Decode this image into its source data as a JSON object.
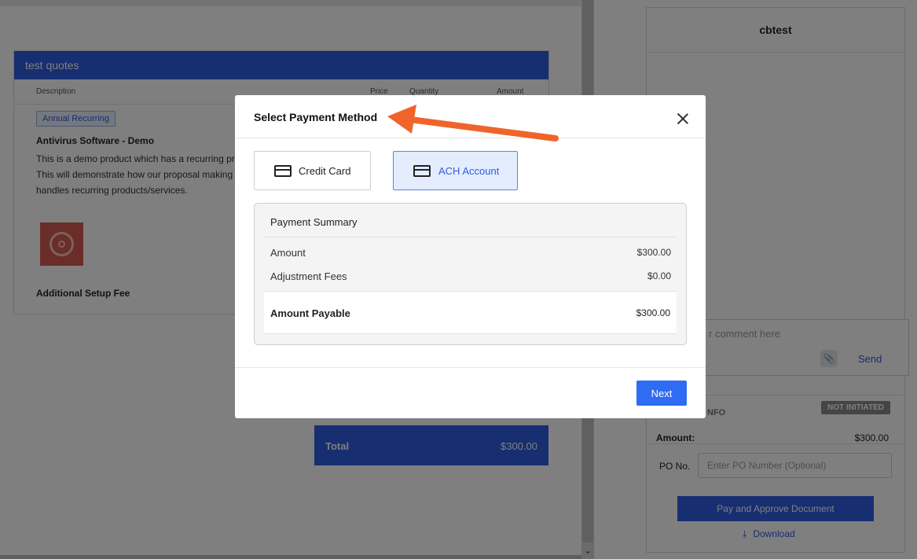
{
  "document": {
    "quote_title": "test quotes",
    "columns": {
      "description": "Description",
      "price": "Price",
      "quantity": "Quantity",
      "amount": "Amount"
    },
    "item": {
      "badge": "Annual Recurring",
      "name": "Antivirus Software - Demo",
      "description": "This is a demo product which has a recurring pr\nThis will demonstrate how our proposal making\nhandles recurring products/services."
    },
    "setup_fee_label": "Additional Setup Fee",
    "total": {
      "label": "Total",
      "value": "$300.00"
    },
    "scroll_down_icon": "⌄"
  },
  "side_panel": {
    "title": "cbtest",
    "comment_placeholder": "r comment here",
    "send_label": "Send",
    "info_label": "NFO",
    "status_badge": "NOT INITIATED",
    "amount_label": "Amount:",
    "amount_value": "$300.00",
    "po_label": "PO No.",
    "po_placeholder": "Enter PO Number (Optional)",
    "pay_button": "Pay and Approve Document",
    "download_label": "Download"
  },
  "modal": {
    "title": "Select Payment Method",
    "methods": [
      {
        "label": "Credit Card",
        "icon": "credit-card-icon",
        "selected": false
      },
      {
        "label": "ACH Account",
        "icon": "credit-card-icon",
        "selected": true
      }
    ],
    "summary": {
      "title": "Payment Summary",
      "rows": [
        {
          "label": "Amount",
          "value": "$300.00"
        },
        {
          "label": "Adjustment Fees",
          "value": "$0.00"
        }
      ],
      "payable_label": "Amount Payable",
      "payable_value": "$300.00"
    },
    "next_label": "Next"
  },
  "colors": {
    "primary": "#2f5ce0",
    "next_button": "#2f6bf3",
    "selected_method_bg": "#e4edfd",
    "annotation_arrow": "#f0642c",
    "status_badge": "#8a8a8a"
  }
}
